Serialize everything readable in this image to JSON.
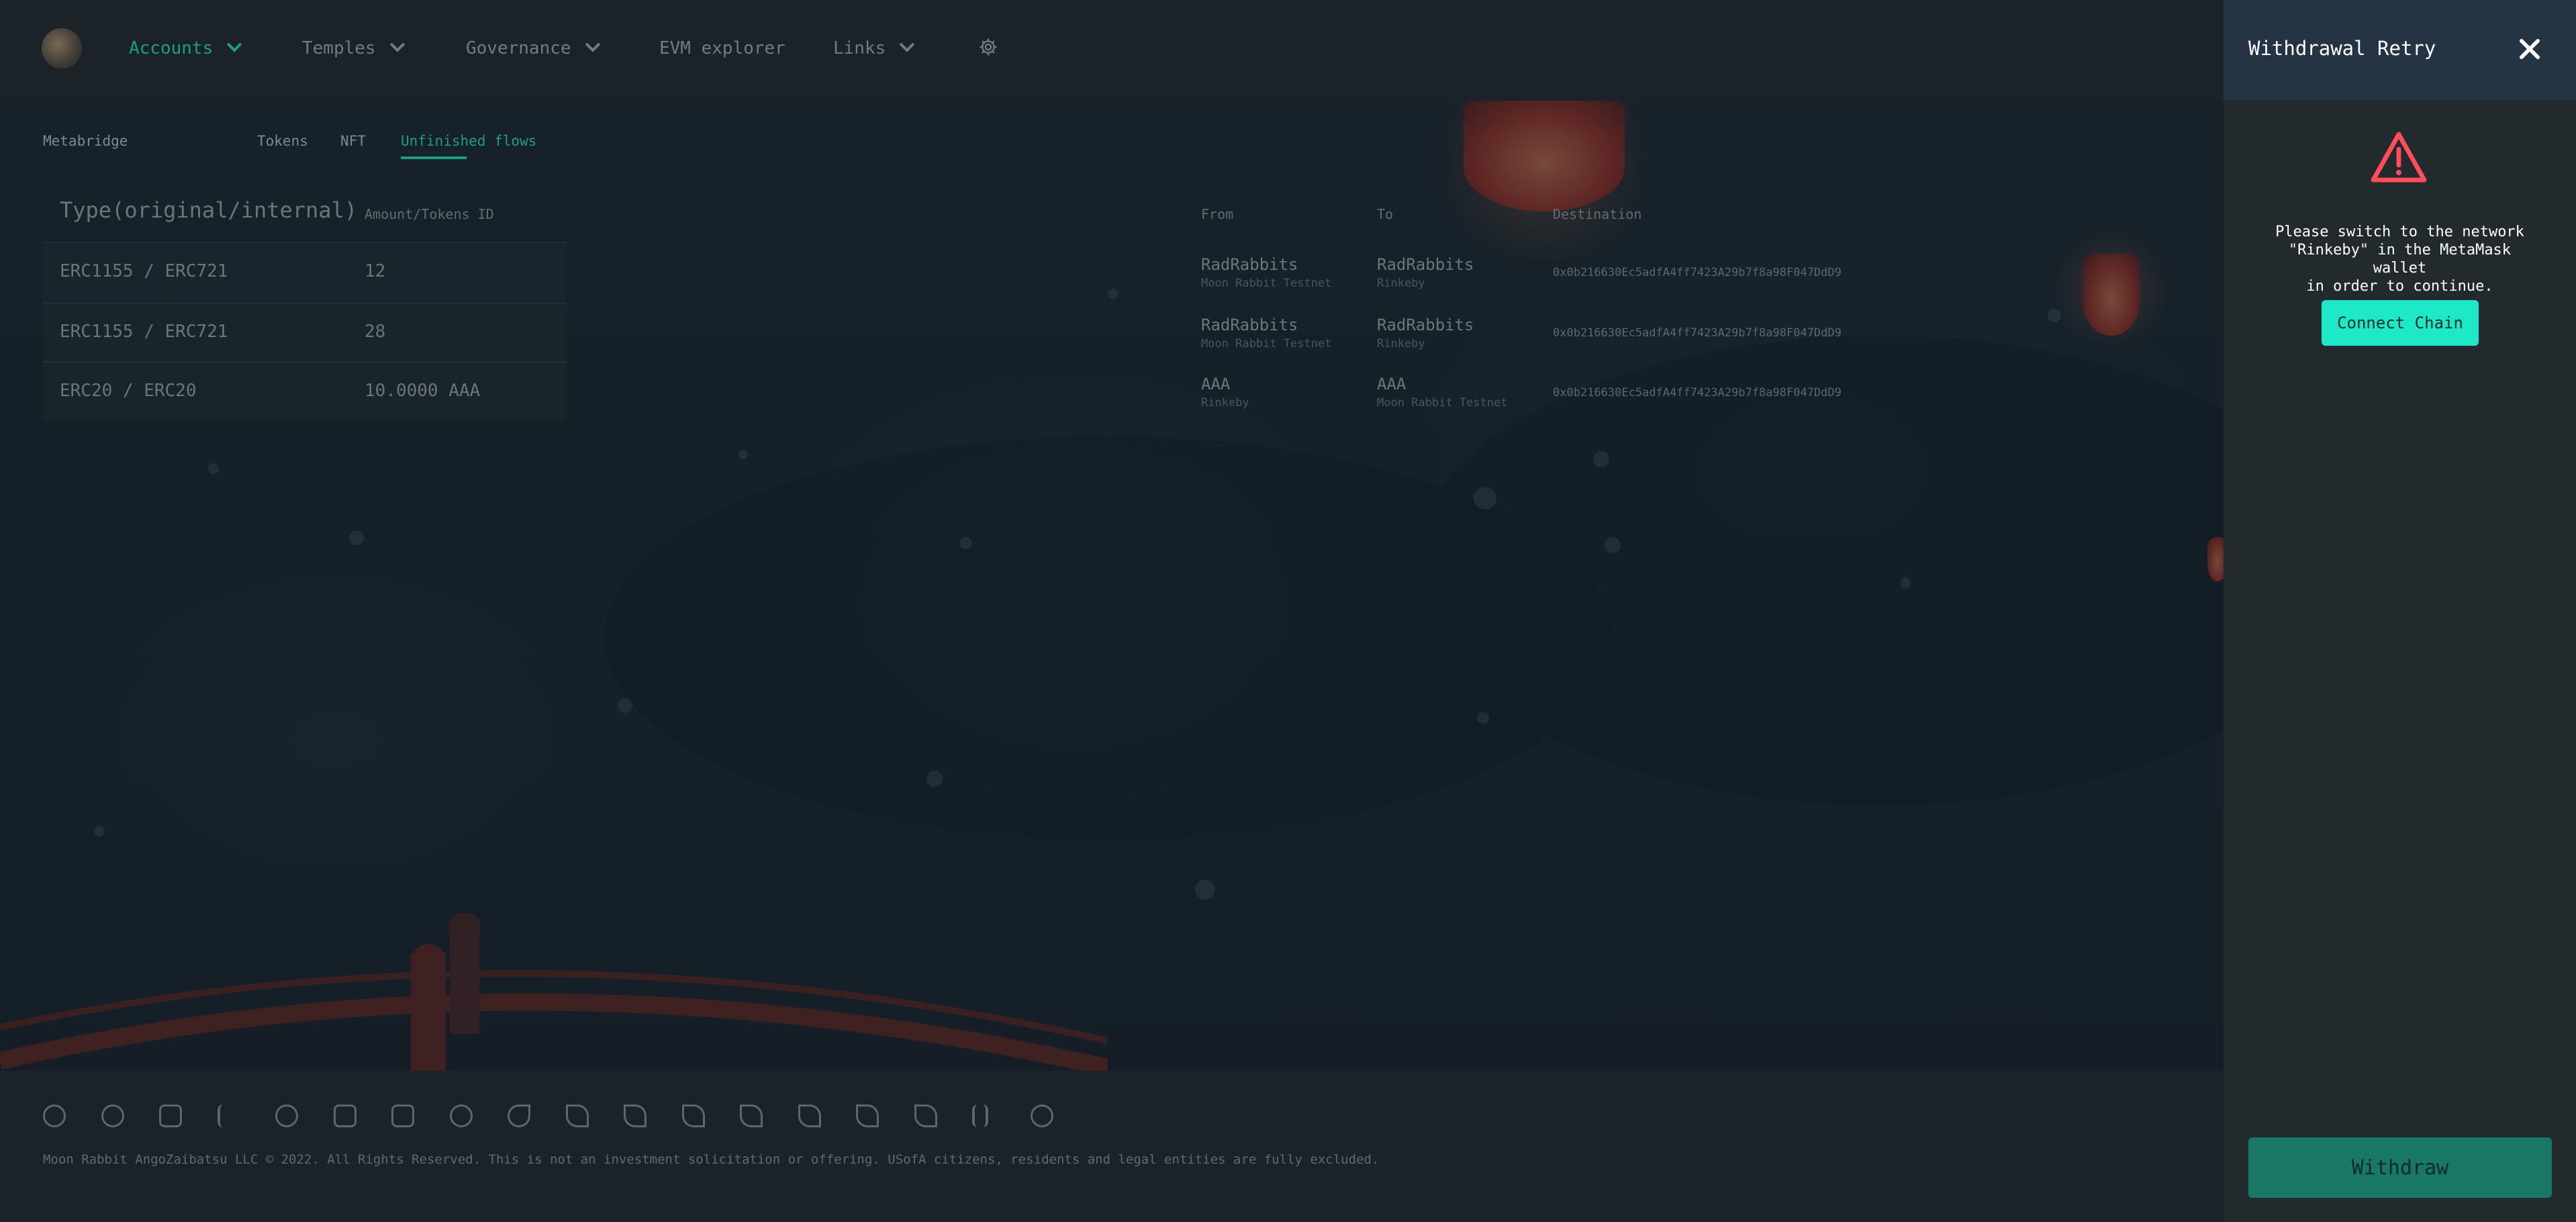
{
  "nav": {
    "items": [
      {
        "label": "Accounts",
        "active": true,
        "dropdown": true
      },
      {
        "label": "Temples",
        "active": false,
        "dropdown": true
      },
      {
        "label": "Governance",
        "active": false,
        "dropdown": true
      },
      {
        "label": "EVM explorer",
        "active": false,
        "dropdown": false
      },
      {
        "label": "Links",
        "active": false,
        "dropdown": true
      }
    ],
    "settings_icon": "gear-icon"
  },
  "subnav": {
    "section": "Metabridge",
    "tabs": [
      "Tokens",
      "NFT",
      "Unfinished flows"
    ],
    "active_tab": "Unfinished flows"
  },
  "table": {
    "headers": {
      "type": "Type(original/internal)",
      "amount": "Amount/Tokens ID",
      "from": "From",
      "to": "To",
      "destination": "Destination"
    },
    "rows": [
      {
        "type": "ERC1155 / ERC721",
        "amount": "12",
        "from": "RadRabbits",
        "from_net": "Moon Rabbit Testnet",
        "to": "RadRabbits",
        "to_net": "Rinkeby",
        "destination": "0x0b216630Ec5adfA4ff7423A29b7f8a98F047DdD9"
      },
      {
        "type": "ERC1155 / ERC721",
        "amount": "28",
        "from": "RadRabbits",
        "from_net": "Moon Rabbit Testnet",
        "to": "RadRabbits",
        "to_net": "Rinkeby",
        "destination": "0x0b216630Ec5adfA4ff7423A29b7f8a98F047DdD9"
      },
      {
        "type": "ERC20 / ERC20",
        "amount": "10.0000 AAA",
        "from": "AAA",
        "from_net": "Rinkeby",
        "to": "AAA",
        "to_net": "Moon Rabbit Testnet",
        "destination": "0x0b216630Ec5adfA4ff7423A29b7f8a98F047DdD9"
      }
    ]
  },
  "footer": {
    "social_icons": [
      "medium-icon",
      "coin-icon",
      "discord-icon",
      "facebook-icon",
      "github-icon",
      "instagram-icon",
      "linkedin-icon",
      "reddit-icon",
      "twitter-icon",
      "telegram-icon",
      "telegram-icon",
      "telegram-icon",
      "telegram-icon",
      "telegram-icon",
      "telegram-icon",
      "telegram-icon",
      "bitcoin-icon",
      "weibo-icon"
    ],
    "copyright": "Moon Rabbit AngoZaibatsu LLC © 2022. All Rights Reserved. This is not an investment solicitation or offering. USofA citizens, residents and legal entities are fully excluded."
  },
  "panel": {
    "title": "Withdrawal Retry",
    "message_lines": [
      "Please switch to the network",
      "\"Rinkeby\" in the MetaMask wallet",
      "in order to continue."
    ],
    "connect_label": "Connect Chain",
    "withdraw_label": "Withdraw"
  },
  "colors": {
    "accent": "#1c9e86",
    "connect_button": "#1de9c6",
    "withdraw_button": "#187865",
    "warning": "#ff4d5a",
    "panel_header": "#253443"
  }
}
